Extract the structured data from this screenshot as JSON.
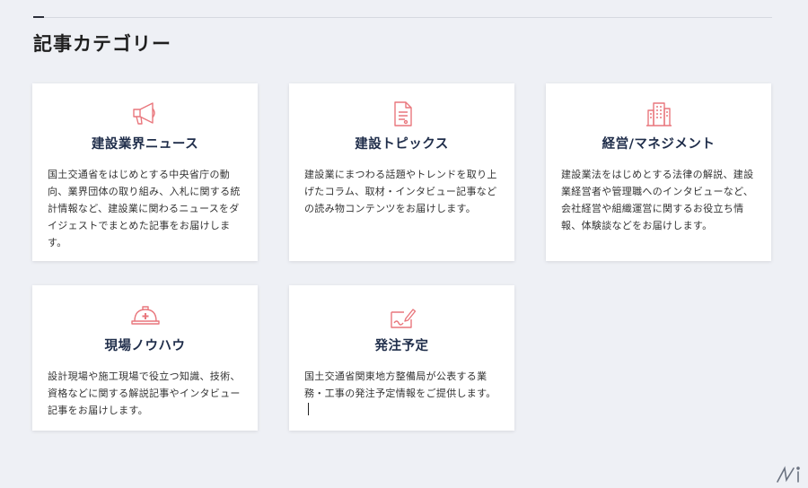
{
  "section": {
    "title": "記事カテゴリー"
  },
  "cards": [
    {
      "icon": "megaphone-icon",
      "title": "建設業界ニュース",
      "description": "国土交通省をはじめとする中央省庁の動向、業界団体の取り組み、入札に関する統計情報など、建設業に関わるニュースをダイジェストでまとめた記事をお届けします。"
    },
    {
      "icon": "document-icon",
      "title": "建設トピックス",
      "description": "建設業にまつわる話題やトレンドを取り上げたコラム、取材・インタビュー記事などの読み物コンテンツをお届けします。"
    },
    {
      "icon": "building-icon",
      "title": "経営/マネジメント",
      "description": "建設業法をはじめとする法律の解説、建設業経営者や管理職へのインタビューなど、会社経営や組織運営に関するお役立ち情報、体験談などをお届けします。"
    },
    {
      "icon": "hard-hat-icon",
      "title": "現場ノウハウ",
      "description": "設計現場や施工現場で役立つ知識、技術、資格などに関する解説記事やインタビュー記事をお届けします。"
    },
    {
      "icon": "pen-order-icon",
      "title": "発注予定",
      "description": "国土交通省関東地方整備局が公表する業務・工事の発注予定情報をご提供します。"
    }
  ],
  "colors": {
    "background": "#eef0f5",
    "card": "#ffffff",
    "icon_accent": "#e9777d",
    "title_text": "#1f2d4a"
  }
}
